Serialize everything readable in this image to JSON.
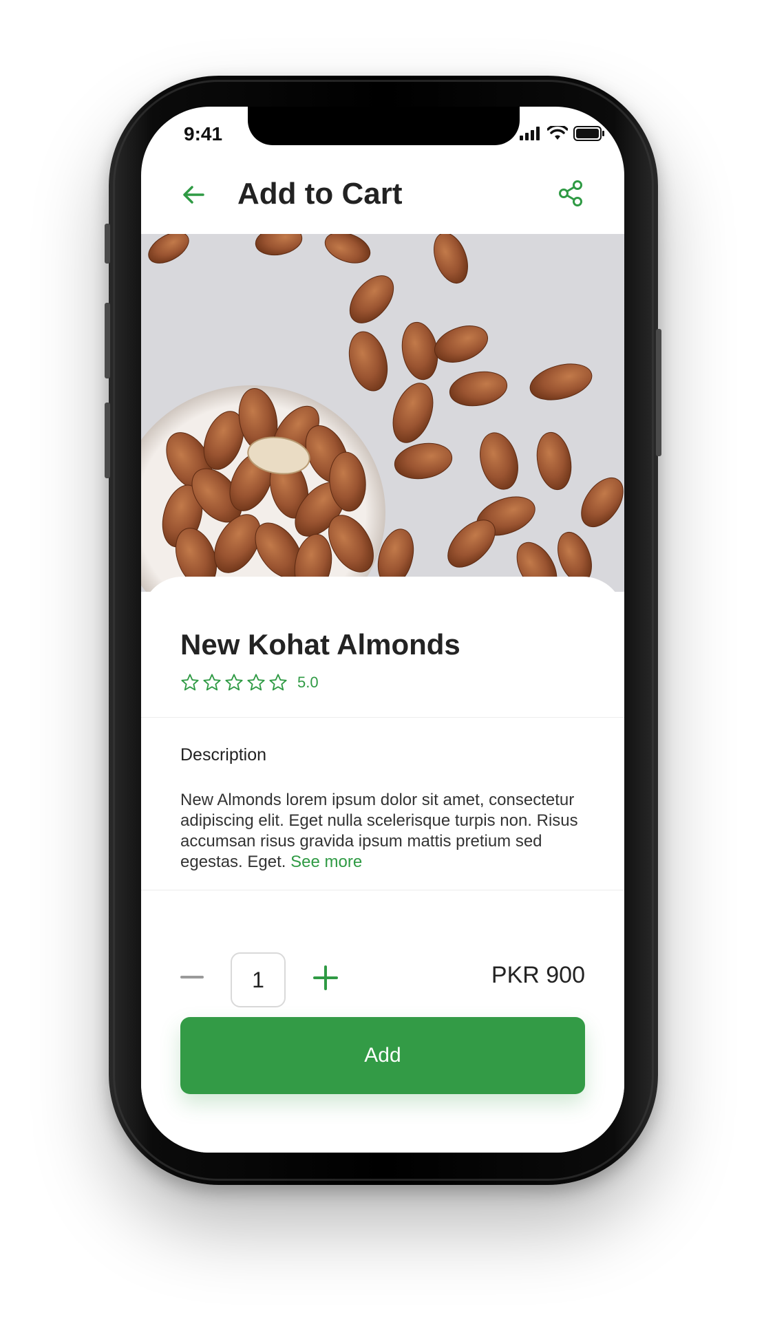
{
  "status_bar": {
    "time": "9:41",
    "icons": [
      "signal-icon",
      "wifi-icon",
      "battery-icon"
    ]
  },
  "header": {
    "title": "Add to Cart",
    "back_icon": "back-arrow-icon",
    "share_icon": "share-icon"
  },
  "product": {
    "name": "New Kohat Almonds",
    "rating": "5.0",
    "stars": 5,
    "image": "almonds-photo"
  },
  "description": {
    "heading": "Description",
    "text": "New Almonds lorem ipsum dolor sit amet, consectetur adipiscing elit. Eget nulla scelerisque turpis non. Risus accumsan risus gravida ipsum mattis pretium sed egestas. Eget.",
    "see_more": "See more"
  },
  "cart": {
    "quantity": "1",
    "price": "PKR 900",
    "add_label": "Add"
  },
  "colors": {
    "accent": "#339b46",
    "text": "#232323"
  }
}
